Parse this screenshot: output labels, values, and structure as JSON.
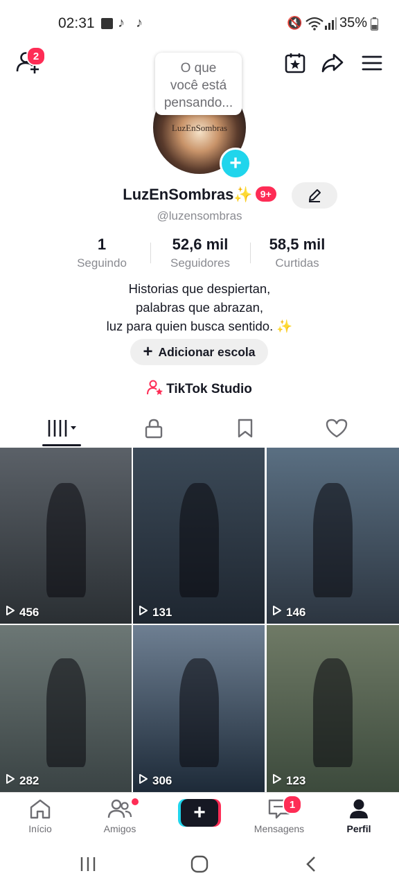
{
  "status_bar": {
    "time": "02:31",
    "battery": "35%"
  },
  "header": {
    "notification_count": "2"
  },
  "thought_bubble": "O que\nvocê está\npensando...",
  "avatar_text": "LuzEnSombras",
  "profile": {
    "name": "LuzEnSombras✨",
    "badge": "9+",
    "handle": "@luzensombras"
  },
  "stats": [
    {
      "value": "1",
      "label": "Seguindo"
    },
    {
      "value": "52,6 mil",
      "label": "Seguidores"
    },
    {
      "value": "58,5 mil",
      "label": "Curtidas"
    }
  ],
  "bio": {
    "line1": "Historias que despiertan,",
    "line2": "palabras que abrazan,",
    "line3": "luz para quien busca sentido. ✨"
  },
  "add_school_label": "Adicionar escola",
  "studio_label": "TikTok Studio",
  "videos": [
    {
      "views": "456",
      "colors": [
        "#2a2f33",
        "#5b6168"
      ]
    },
    {
      "views": "131",
      "colors": [
        "#1e2630",
        "#3c4a58"
      ]
    },
    {
      "views": "146",
      "colors": [
        "#2c3540",
        "#5a6f82"
      ]
    },
    {
      "views": "282",
      "colors": [
        "#3a4344",
        "#6c7775"
      ]
    },
    {
      "views": "306",
      "colors": [
        "#1d2a38",
        "#6e7f92"
      ]
    },
    {
      "views": "123",
      "colors": [
        "#3c4a3c",
        "#6f7a66"
      ]
    }
  ],
  "nav": {
    "home": "Início",
    "friends": "Amigos",
    "messages": "Mensagens",
    "messages_badge": "1",
    "profile": "Perfil"
  },
  "colors": {
    "accent": "#fe2c55",
    "cyan": "#20d5ec",
    "text": "#161823",
    "muted": "#8a8b91"
  }
}
